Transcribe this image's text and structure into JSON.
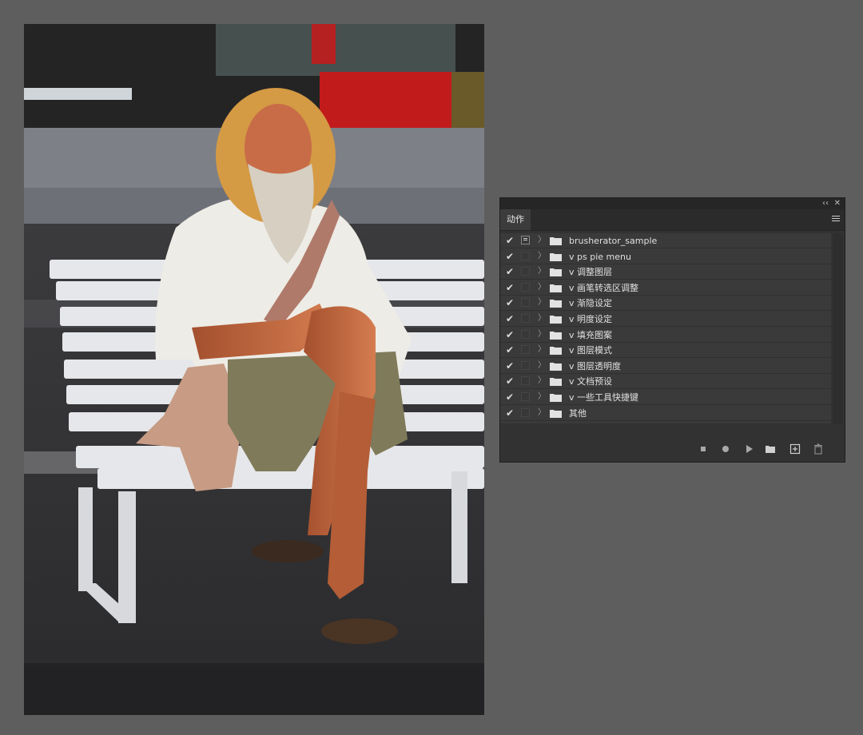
{
  "panel": {
    "tab_label": "动作",
    "collapse_label": "‹‹",
    "close_label": "✕",
    "actions": [
      {
        "label": "brusherator_sample",
        "checked": true,
        "dialog": true
      },
      {
        "label": "v ps pie menu",
        "checked": true,
        "dialog": false
      },
      {
        "label": "v 调整图层",
        "checked": true,
        "dialog": false
      },
      {
        "label": "v 画笔转选区调整",
        "checked": true,
        "dialog": false
      },
      {
        "label": "v 渐隐设定",
        "checked": true,
        "dialog": false
      },
      {
        "label": "v 明度设定",
        "checked": true,
        "dialog": false
      },
      {
        "label": "v 填充图案",
        "checked": true,
        "dialog": false
      },
      {
        "label": "v 图层模式",
        "checked": true,
        "dialog": false
      },
      {
        "label": "v 图层透明度",
        "checked": true,
        "dialog": false
      },
      {
        "label": "v 文档预设",
        "checked": true,
        "dialog": false
      },
      {
        "label": "v 一些工具快捷键",
        "checked": true,
        "dialog": false
      },
      {
        "label": "其他",
        "checked": true,
        "dialog": false
      }
    ],
    "toolbar_icons": [
      "stop-icon",
      "record-icon",
      "play-icon",
      "new-set-icon",
      "new-action-icon",
      "delete-icon"
    ]
  },
  "colors": {
    "workspace_bg": "#5e5e5e",
    "panel_bg": "#323232",
    "list_bg": "#3a3a3a"
  }
}
